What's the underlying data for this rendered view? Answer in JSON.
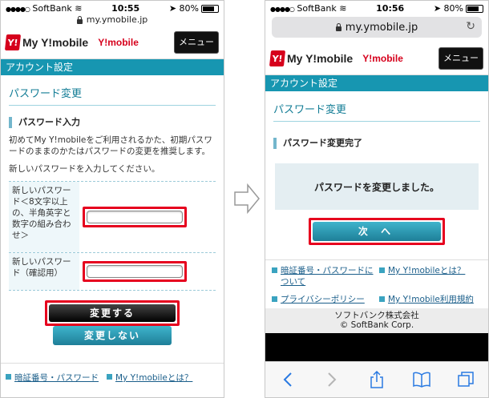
{
  "left": {
    "status": {
      "carrier": "SoftBank",
      "time": "10:55",
      "battery": "80%"
    },
    "url": "my.ymobile.jp",
    "header": {
      "brand": "My Y!mobile",
      "ylogo": "Y!mobile",
      "menu": "メニュー"
    },
    "section": "アカウント設定",
    "title": "パスワード変更",
    "subhead": "パスワード入力",
    "intro": "初めてMy Y!mobileをご利用されるかた、初期パスワードのままのかたはパスワードの変更を推奨します。",
    "instruction": "新しいパスワードを入力してください。",
    "fields": {
      "new_password_label": "新しいパスワード＜8文字以上の、半角英字と数字の組み合わせ＞",
      "confirm_password_label": "新しいパスワード（確認用）",
      "new_password_value": "",
      "confirm_password_value": ""
    },
    "buttons": {
      "change": "変更する",
      "cancel": "変更しない"
    },
    "links": [
      "暗証番号・パスワード",
      "My Y!mobileとは？"
    ]
  },
  "right": {
    "status": {
      "carrier": "SoftBank",
      "time": "10:56",
      "battery": "80%"
    },
    "url": "my.ymobile.jp",
    "header": {
      "brand": "My Y!mobile",
      "ylogo": "Y!mobile",
      "menu": "メニュー"
    },
    "section": "アカウント設定",
    "title": "パスワード変更",
    "subhead": "パスワード変更完了",
    "message": "パスワードを変更しました。",
    "next_button": "次 へ",
    "links": [
      "暗証番号・パスワードについて",
      "My Y!mobileとは？",
      "プライバシーポリシー",
      "My Y!mobile利用規約"
    ],
    "footer": {
      "company": "ソフトバンク株式会社",
      "copyright": "© SoftBank Corp."
    }
  },
  "colors": {
    "accent": "#1796b1",
    "highlight": "#e6001e",
    "brand_red": "#d6001c"
  }
}
